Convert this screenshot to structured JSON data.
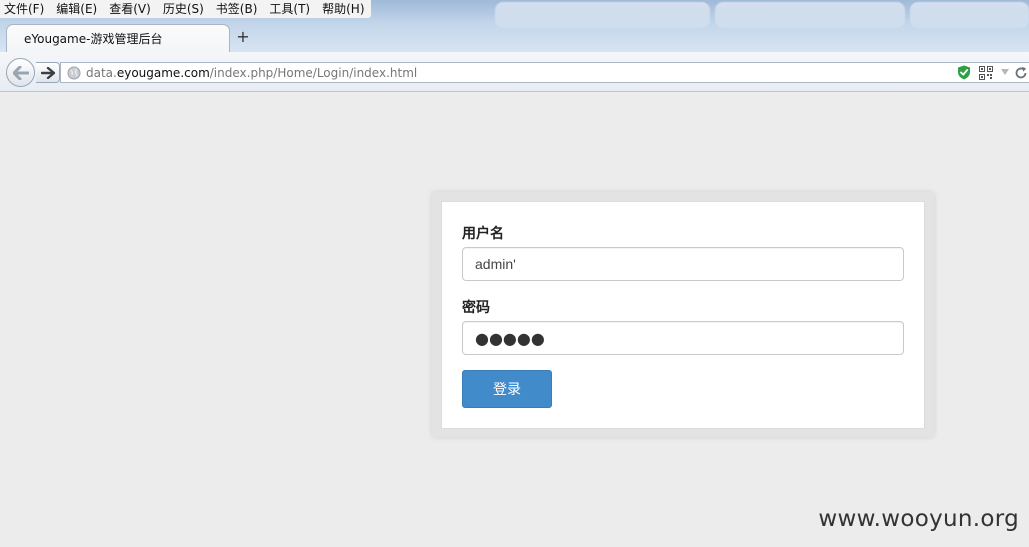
{
  "menu": [
    "文件(F)",
    "编辑(E)",
    "查看(V)",
    "历史(S)",
    "书签(B)",
    "工具(T)",
    "帮助(H)"
  ],
  "tab": {
    "title": "eYougame-游戏管理后台",
    "new_tab_symbol": "+"
  },
  "address": {
    "prefix": "data.",
    "domain": "eyougame.com",
    "path": "/index.php/Home/Login/index.html"
  },
  "form": {
    "username_label": "用户名",
    "username_value": "admin'",
    "password_label": "密码",
    "password_masked": "●●●●●",
    "submit_label": "登录"
  },
  "colors": {
    "button": "#428bca",
    "page_bg": "#ececec",
    "shield": "#2ea043"
  },
  "watermark": "www.wooyun.org"
}
